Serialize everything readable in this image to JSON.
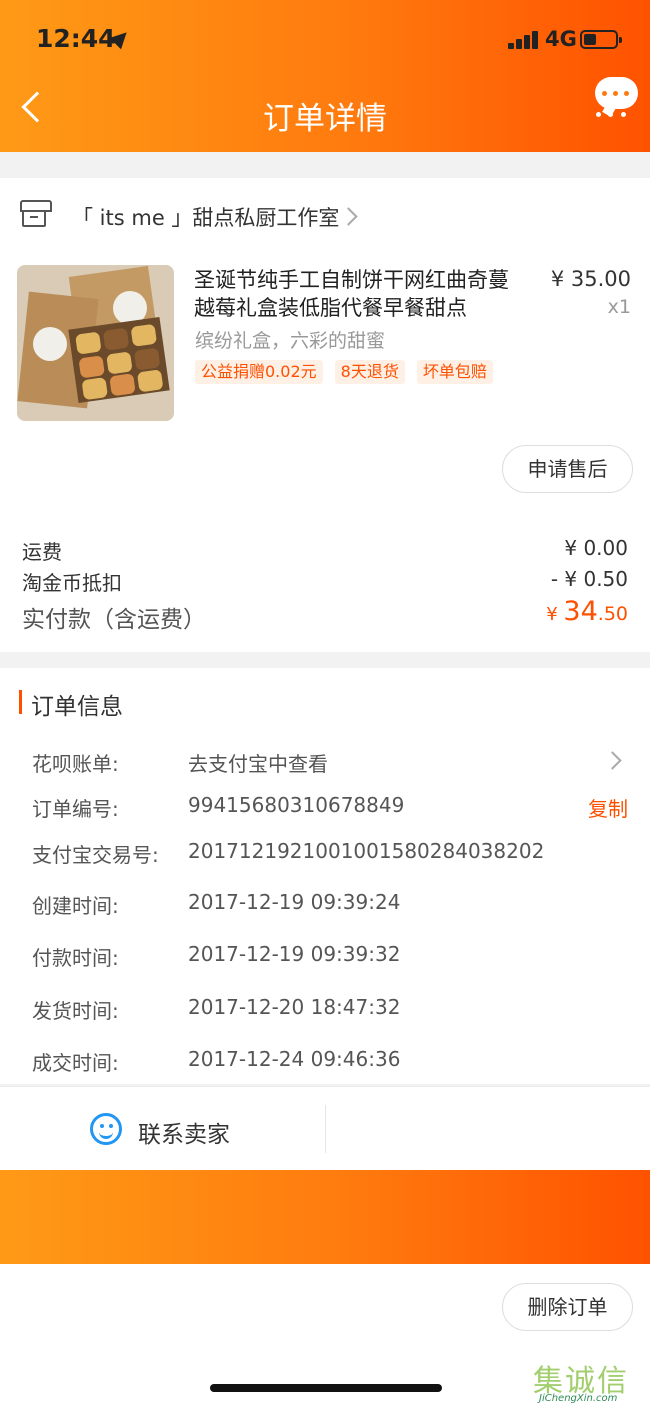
{
  "status_bar": {
    "time": "12:44",
    "network": "4G"
  },
  "nav": {
    "title": "订单详情"
  },
  "shop": {
    "name": "「 its me 」甜点私厨工作室"
  },
  "product": {
    "title": "圣诞节纯手工自制饼干网红曲奇蔓越莓礼盒装低脂代餐早餐甜点",
    "price": "¥ 35.00",
    "quantity": "x1",
    "spec": "缤纷礼盒，六彩的甜蜜",
    "tags": [
      "公益捐赠0.02元",
      "8天退货",
      "坏单包赔"
    ]
  },
  "after_sale_button": "申请售后",
  "fees": [
    {
      "label": "运费",
      "value": "¥ 0.00"
    },
    {
      "label": "淘金币抵扣",
      "value": "- ¥ 0.50"
    }
  ],
  "total": {
    "label": "实付款（含运费）",
    "currency": "¥ ",
    "integer": "34",
    "decimal": ".50"
  },
  "order_info": {
    "title": "订单信息",
    "rows": [
      {
        "label": "花呗账单:",
        "value": "去支付宝中查看"
      },
      {
        "label": "订单编号:",
        "value": "99415680310678849"
      },
      {
        "label": "支付宝交易号:",
        "value": "2017121921001001580284038202"
      },
      {
        "label": "创建时间:",
        "value": "2017-12-19 09:39:24"
      },
      {
        "label": "付款时间:",
        "value": "2017-12-19 09:39:32"
      },
      {
        "label": "发货时间:",
        "value": "2017-12-20 18:47:32"
      },
      {
        "label": "成交时间:",
        "value": "2017-12-24 09:46:36"
      }
    ],
    "copy_label": "复制"
  },
  "contact": {
    "label": "联系卖家"
  },
  "delete_button": "删除订单",
  "watermark": {
    "brand": "集诚信",
    "url": "JiChengXin.com"
  }
}
